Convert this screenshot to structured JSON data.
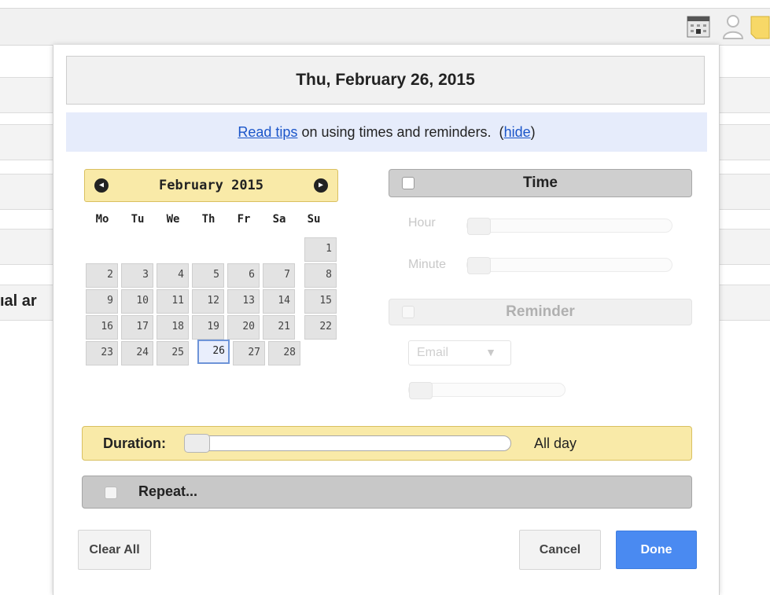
{
  "background": {
    "partial_text": "ıal ar",
    "icons": [
      "calendar-icon",
      "user-icon",
      "note-icon"
    ]
  },
  "modal": {
    "date_title": "Thu, February 26, 2015",
    "tips": {
      "link_text": "Read tips",
      "middle_text": " on using times and reminders.  (",
      "hide_text": "hide",
      "end_text": ")"
    },
    "calendar": {
      "month_label": "February 2015",
      "prev_icon": "chevron-left-icon",
      "next_icon": "chevron-right-icon",
      "weekdays": [
        "Mo",
        "Tu",
        "We",
        "Th",
        "Fr",
        "Sa",
        "Su"
      ],
      "days": [
        "1",
        "2",
        "3",
        "4",
        "5",
        "6",
        "7",
        "8",
        "9",
        "10",
        "11",
        "12",
        "13",
        "14",
        "15",
        "16",
        "17",
        "18",
        "19",
        "20",
        "21",
        "22",
        "23",
        "24",
        "25",
        "26",
        "27",
        "28"
      ],
      "selected_day": "26"
    },
    "time": {
      "label": "Time",
      "checked": false,
      "hour_label": "Hour",
      "minute_label": "Minute"
    },
    "reminder": {
      "label": "Reminder",
      "checked": false,
      "method_value": "Email",
      "dropdown_arrow": "▼"
    },
    "duration": {
      "label": "Duration:",
      "value": "All day",
      "slider_fraction": 0
    },
    "repeat": {
      "label": "Repeat...",
      "checked": false
    },
    "buttons": {
      "clear": "Clear All",
      "cancel": "Cancel",
      "done": "Done"
    }
  },
  "colors": {
    "highlight_yellow": "#f9eaa8",
    "tips_blue": "#e6ecfb",
    "link_blue": "#1a55c9",
    "done_blue": "#4a8af1"
  }
}
